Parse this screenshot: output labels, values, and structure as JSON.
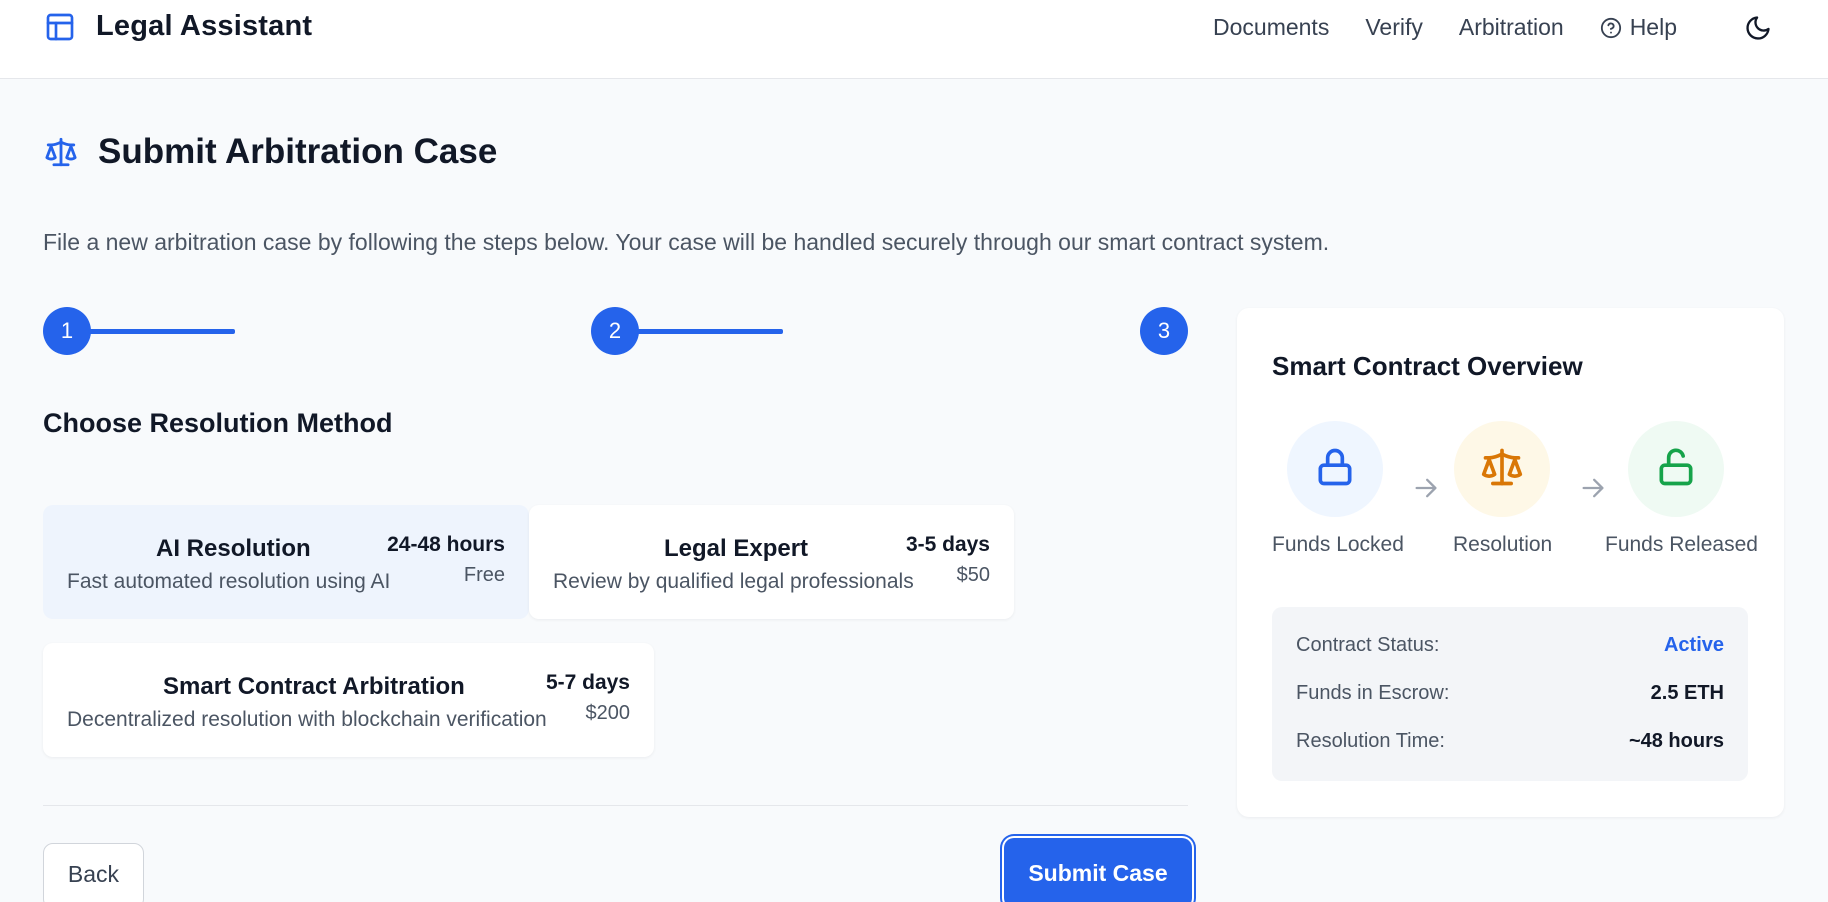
{
  "header": {
    "brand_icon": "layout-icon",
    "title": "Legal Assistant",
    "nav": [
      "Documents",
      "Verify",
      "Arbitration",
      "Help"
    ],
    "help_icon": "question-circle-icon",
    "theme_icon": "moon-icon"
  },
  "page": {
    "title_icon": "scales-icon",
    "title": "Submit Arbitration Case",
    "subtitle": "File a new arbitration case by following the steps below. Your case will be handled securely through our smart contract system."
  },
  "stepper": {
    "steps": [
      "1",
      "2",
      "3"
    ],
    "current_step": 3
  },
  "method": {
    "section_title": "Choose Resolution Method",
    "options": [
      {
        "name": "AI Resolution",
        "description": "Fast automated resolution using AI",
        "duration": "24-48 hours",
        "price": "Free",
        "selected": true
      },
      {
        "name": "Legal Expert",
        "description": "Review by qualified legal professionals",
        "duration": "3-5 days",
        "price": "$50",
        "selected": false
      },
      {
        "name": "Smart Contract Arbitration",
        "description": "Decentralized resolution with blockchain verification",
        "duration": "5-7 days",
        "price": "$200",
        "selected": false
      }
    ]
  },
  "actions": {
    "back": "Back",
    "submit": "Submit Case"
  },
  "overview": {
    "title": "Smart Contract Overview",
    "flow": [
      {
        "label": "Funds Locked",
        "icon": "lock-icon",
        "color": "#2563eb",
        "bg": "#eff6ff"
      },
      {
        "label": "Resolution",
        "icon": "scales-icon",
        "color": "#d97706",
        "bg": "#fef8e7"
      },
      {
        "label": "Funds Released",
        "icon": "unlock-icon",
        "color": "#16a34a",
        "bg": "#effaf3"
      }
    ],
    "arrow_icon": "arrow-right-icon",
    "status": [
      {
        "key": "Contract Status:",
        "value": "Active"
      },
      {
        "key": "Funds in Escrow:",
        "value": "2.5 ETH"
      },
      {
        "key": "Resolution Time:",
        "value": "~48 hours"
      }
    ]
  },
  "colors": {
    "primary": "#2563eb",
    "background": "#f8fafc",
    "selected_card": "#eef4fd"
  }
}
